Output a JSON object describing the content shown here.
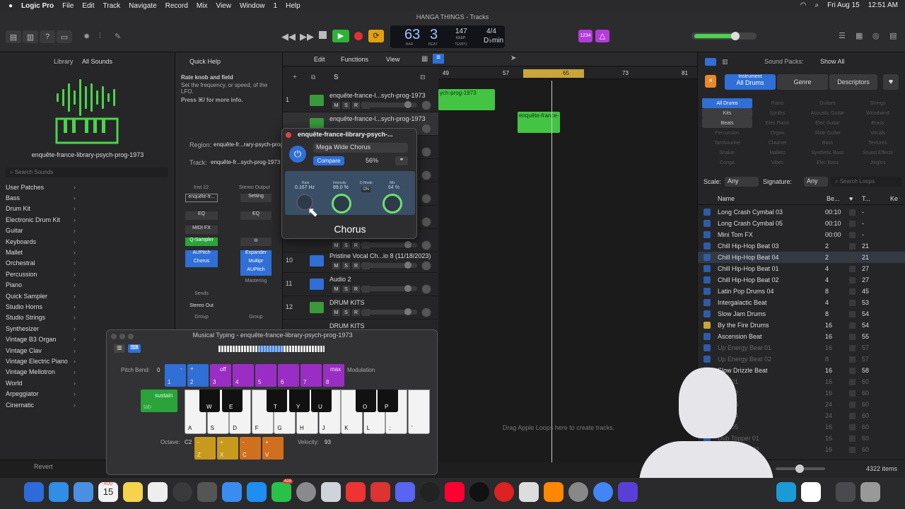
{
  "menubar": {
    "app": "Logic Pro",
    "items": [
      "File",
      "Edit",
      "Track",
      "Navigate",
      "Record",
      "Mix",
      "View",
      "Window",
      "1",
      "Help"
    ],
    "date": "Fri Aug 15",
    "time": "12:51 AM"
  },
  "window": {
    "title": "HANGA THINGS - Tracks"
  },
  "lcd": {
    "bar": "63",
    "beat": "3",
    "bar_label": "BAR",
    "beat_label": "BEAT",
    "tempo": "147",
    "tempo_label": "TEMPO",
    "keep": "KEEP",
    "sig": "4/4",
    "key": "D♭min",
    "count": "1234"
  },
  "library": {
    "title": "Library",
    "filter": "All Sounds",
    "patch_name": "enquête-france-library-psych-prog-1973",
    "search_placeholder": "Search Sounds",
    "items": [
      "User Patches",
      "Bass",
      "Drum Kit",
      "Electronic Drum Kit",
      "Guitar",
      "Keyboards",
      "Mallet",
      "Orchestral",
      "Percussion",
      "Piano",
      "Quick Sampler",
      "Studio Horns",
      "Studio Strings",
      "Synthesizer",
      "Vintage B3 Organ",
      "Vintage Clav",
      "Vintage Electric Piano",
      "Vintage Mellotron",
      "World",
      "Arpeggiator",
      "Cinematic"
    ],
    "revert": "Revert"
  },
  "quickhelp": {
    "title": "Quick Help",
    "heading": "Rate knob and field",
    "body": "Set the frequency, or speed, of the LFO.",
    "more": "Press ⌘/ for more info.",
    "region_label": "Region:",
    "region_value": "enquête-fr...rary-psych-prog-1973",
    "track_label": "Track:",
    "track_value": "enquête-fr...sych-prog-1973"
  },
  "strip": {
    "inst": "Inst 22",
    "stereo_out": "Stereo Output",
    "instname": "enquête-fr...",
    "setting": "Setting",
    "eq": "EQ",
    "midifx": "MIDI FX",
    "qsampler": "Q-Sampler",
    "aupitch": "AUPitch",
    "chorus": "Chorus",
    "expander": "Expander",
    "multipr": "Multipr",
    "aupitch2": "AUPitch",
    "mastering": "Mastering",
    "sends": "Sends",
    "stereo": "Stereo Out",
    "group": "Group",
    "group2": "Group"
  },
  "trackbar": {
    "edit": "Edit",
    "functions": "Functions",
    "view": "View"
  },
  "tracks": [
    {
      "num": "1",
      "name": "enquête-france-l...sych-prog-1973"
    },
    {
      "num": "",
      "name": "enquête-france-l...sych-prog-1973"
    },
    {
      "num": "10",
      "name": "Pristine Vocal Ch...io 8 (11/18/2023)"
    },
    {
      "num": "11",
      "name": "Audio 2"
    },
    {
      "num": "12",
      "name": "DRUM KITS"
    },
    {
      "num": "",
      "name": "DRUM KITS"
    }
  ],
  "msr": [
    "M",
    "S",
    "R",
    "I"
  ],
  "ruler": [
    "49",
    "57",
    "65",
    "73",
    "81"
  ],
  "regions": [
    "ych-prog-1973",
    "enquête-france-"
  ],
  "arrange_hint": "Drag Apple Loops here to create tracks.",
  "plugin": {
    "title": "enquête-france-library-psych-...",
    "preset": "Mega Wide Chorus",
    "compare": "Compare",
    "mix": "56%",
    "rate_label": "Rate",
    "rate_value": "0.167 Hz",
    "intensity_label": "Intensity",
    "intensity_value": "89.0 %",
    "dmode_label": "D-Mode",
    "dmode_value": "ON",
    "mix_label": "Mix",
    "mix_value": "64 %",
    "name": "Chorus"
  },
  "mtyping": {
    "title": "Musical Typing - enquête-france-library-psych-prog-1973",
    "pitch_bend": "Pitch Bend:",
    "pb_value": "0",
    "modulation": "Modulation",
    "sustain": "sustain",
    "tab": "tab",
    "octave": "Octave:",
    "octave_value": "C2",
    "velocity": "Velocity:",
    "velocity_value": "93",
    "off": "off",
    "max": "max",
    "pb_keys": [
      "1",
      "2"
    ],
    "mod_keys": [
      "3",
      "4",
      "5",
      "6",
      "7",
      "8"
    ],
    "white": [
      "A",
      "S",
      "D",
      "F",
      "G",
      "H",
      "J",
      "K",
      "L",
      ";",
      "'"
    ],
    "black": [
      "W",
      "E",
      "T",
      "Y",
      "U",
      "O",
      "P"
    ],
    "oct_keys": [
      "Z",
      "X"
    ],
    "vel_keys": [
      "C",
      "V"
    ]
  },
  "browser": {
    "sound_packs": "Sound Packs:",
    "show_all": "Show All",
    "instrument": "Instrument",
    "all_drums": "All Drums",
    "genre": "Genre",
    "descriptors": "Descriptors",
    "filters": [
      "All Drums",
      "Piano",
      "Guitars",
      "Strings",
      "Kits",
      "Synths",
      "Acoustic Guitar",
      "Woodwind",
      "Beats",
      "Elec Piano",
      "Elec Guitar",
      "Brass",
      "Percussion",
      "Organ",
      "Slide Guitar",
      "Vocals",
      "Tambourine",
      "Clavinet",
      "Bass",
      "Textures",
      "Shaker",
      "Mallets",
      "Synthetic Bass",
      "Sound Effects",
      "Conga",
      "Vibes",
      "Elec Bass",
      "Jingles"
    ],
    "scale": "Scale:",
    "scale_v": "Any",
    "sig": "Signature:",
    "sig_v": "Any",
    "search_placeholder": "Search Loops",
    "col_name": "Name",
    "col_beats": "Be...",
    "col_tempo": "T...",
    "col_key": "Ke",
    "loops": [
      [
        "Long Crash Cymbal 03",
        "00:10",
        "-"
      ],
      [
        "Long Crash Cymbal 05",
        "00:10",
        "-"
      ],
      [
        "Mini Tom FX",
        "00:00",
        "-"
      ],
      [
        "Chill Hip-Hop Beat 03",
        "2",
        "21"
      ],
      [
        "Chill Hip-Hop Beat 04",
        "2",
        "21"
      ],
      [
        "Chill Hip-Hop Beat 01",
        "4",
        "27"
      ],
      [
        "Chill Hip-Hop Beat 02",
        "4",
        "27"
      ],
      [
        "Latin Pop Drums 04",
        "8",
        "45"
      ],
      [
        "Intergalactic Beat",
        "4",
        "53"
      ],
      [
        "Slow Jam Drums",
        "8",
        "54"
      ],
      [
        "By the Fire Drums",
        "16",
        "54"
      ],
      [
        "Ascension Beat",
        "16",
        "55"
      ],
      [
        "Up Energy Beat 01",
        "16",
        "57"
      ],
      [
        "Up Energy Beat 02",
        "8",
        "57"
      ],
      [
        "Slow Drizzle Beat",
        "16",
        "58"
      ],
      [
        "Dub 01",
        "16",
        "60"
      ],
      [
        "Dub 02",
        "16",
        "60"
      ],
      [
        "Dub 03",
        "24",
        "60"
      ],
      [
        "Dub 04",
        "24",
        "60"
      ],
      [
        "Dub 05",
        "16",
        "60"
      ],
      [
        "Dub Topper 01",
        "16",
        "60"
      ],
      [
        "Dub Topper 02",
        "16",
        "60"
      ]
    ],
    "count": "4322 items"
  },
  "dock": {
    "date_mon": "AUG",
    "date_day": "15",
    "badge": "426"
  }
}
